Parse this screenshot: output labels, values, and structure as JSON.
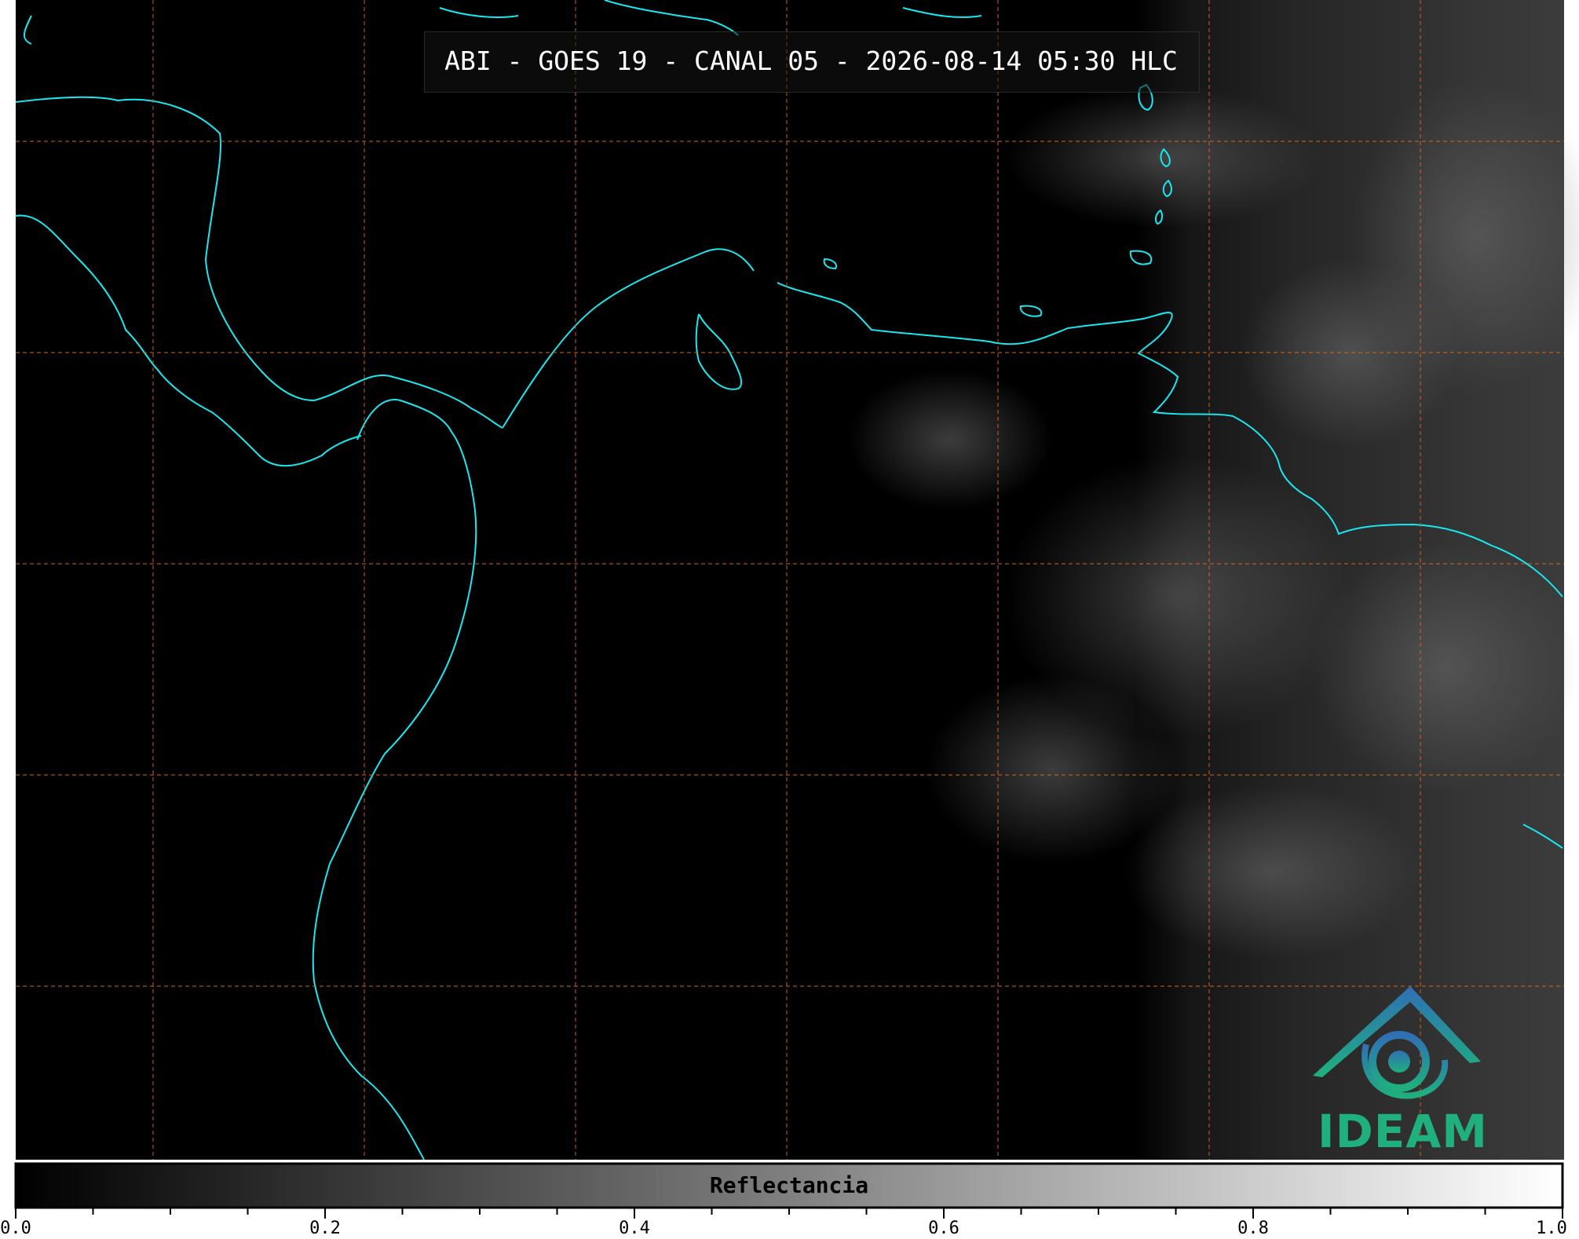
{
  "title": "ABI - GOES 19 - CANAL 05 - 2026-08-14 05:30 HLC",
  "logo": {
    "text": "IDEAM",
    "icon": "ideam-logo-icon"
  },
  "colorbar": {
    "label": "Reflectancia",
    "colormap": "grayscale",
    "range": [
      0.0,
      1.0
    ],
    "tick_labels": [
      "0.0",
      "0.2",
      "0.4",
      "0.6",
      "0.8",
      "1.0"
    ]
  },
  "map_style": {
    "coastline_color": "#19e8f0",
    "graticule_color": "#d2691e",
    "graticule_style": "dashed",
    "background_color": "#000000"
  }
}
